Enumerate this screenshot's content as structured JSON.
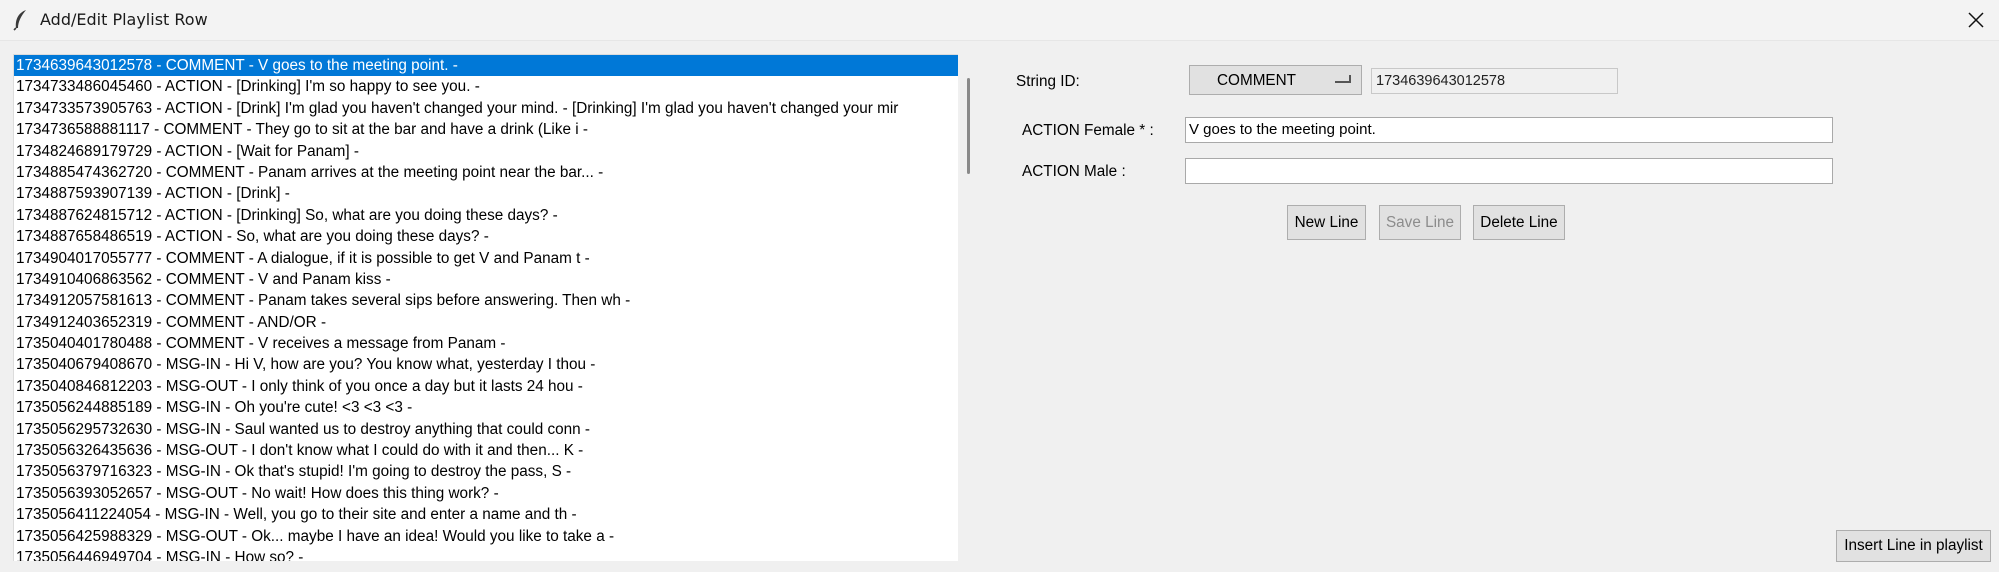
{
  "window": {
    "title": "Add/Edit Playlist Row"
  },
  "list": {
    "selected_index": 0,
    "items": [
      "1734639643012578 - COMMENT - V goes to the meeting point. -",
      "1734733486045460 - ACTION - [Drinking] I'm so happy to see you. -",
      "1734733573905763 - ACTION - [Drink] I'm glad you haven't changed your mind. - [Drinking] I'm glad you haven't changed your mir",
      "1734736588881117 - COMMENT - They go to sit at the bar and have a drink (Like i -",
      "1734824689179729 - ACTION - [Wait for Panam] -",
      "1734885474362720 - COMMENT - Panam arrives at the meeting point near the bar... -",
      "1734887593907139 - ACTION - [Drink] -",
      "1734887624815712 - ACTION - [Drinking] So, what are you doing these days? -",
      "1734887658486519 - ACTION - So, what are you doing these days? -",
      "1734904017055777 - COMMENT - A dialogue, if it is possible to get V and Panam t -",
      "1734910406863562 - COMMENT - V and Panam kiss -",
      "1734912057581613 - COMMENT - Panam takes several sips before answering. Then wh -",
      "1734912403652319 - COMMENT - AND/OR -",
      "1735040401780488 - COMMENT - V receives a message from Panam -",
      "1735040679408670 - MSG-IN - Hi V, how are you? You know what, yesterday I thou -",
      "1735040846812203 - MSG-OUT - I only think of you once a day but it lasts 24 hou -",
      "1735056244885189 - MSG-IN - Oh you're cute! <3 <3 <3 -",
      "1735056295732630 - MSG-IN - Saul wanted us to destroy anything that could conn -",
      "1735056326435636 - MSG-OUT - I don't know what I could do with it and then... K -",
      "1735056379716323 - MSG-IN - Ok that's stupid! I'm going to destroy the pass, S -",
      "1735056393052657 - MSG-OUT - No wait! How does this thing work? -",
      "1735056411224054 - MSG-IN - Well, you go to their site and enter a name and th -",
      "1735056425988329 - MSG-OUT - Ok... maybe I have an idea! Would you like to take a -",
      "1735056446949704 - MSG-IN - How so? -"
    ]
  },
  "form": {
    "string_id_label": "String ID:",
    "type_selected": "COMMENT",
    "string_id_value": "1734639643012578",
    "female_label": "ACTION Female * :",
    "female_value": "V goes to the meeting point.",
    "male_label": "ACTION Male :",
    "male_value": ""
  },
  "buttons": {
    "new_line": "New Line",
    "save_line": "Save Line",
    "delete_line": "Delete Line",
    "insert_line": "Insert Line in playlist"
  },
  "colors": {
    "selection": "#0078d7",
    "window_bg": "#f0f0f0"
  }
}
